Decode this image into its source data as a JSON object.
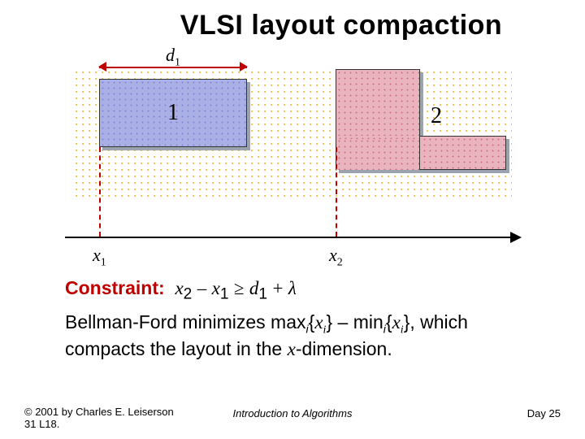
{
  "title": "VLSI layout compaction",
  "figure": {
    "d1_label_html": "<span class='mth'>d</span><sub>1</sub>",
    "block1_label": "1",
    "block2_label": "2",
    "x1_label_html": "<span class='mth'>x</span><sub>1</sub>",
    "x2_label_html": "<span class='mth'>x</span><sub>2</sub>"
  },
  "constraint": {
    "lead": "Constraint:",
    "expr_html": "<span class='mth'>x</span><sub>2</sub> <span class='op'>–</span> <span class='mth'>x</span><sub>1</sub> <span class='op'>≥</span> <span class='mth'>d</span><sub>1</sub> <span class='op'>+</span>  <span class='mth'>λ</span>"
  },
  "body_html": "Bellman-Ford minimizes max<sub>i</sub>{<span class='mth'>x<sub>i</sub></span>} – min<sub>i</sub>{<span class='mth'>x<sub>i</sub></span>}, which compacts the layout in the <span class='mth'>x</span>-dimension.",
  "footer": {
    "left_line1": "© 2001 by Charles E. Leiserson",
    "left_line2": "31    L18.",
    "center": "Introduction to Algorithms",
    "right": "Day   25"
  }
}
